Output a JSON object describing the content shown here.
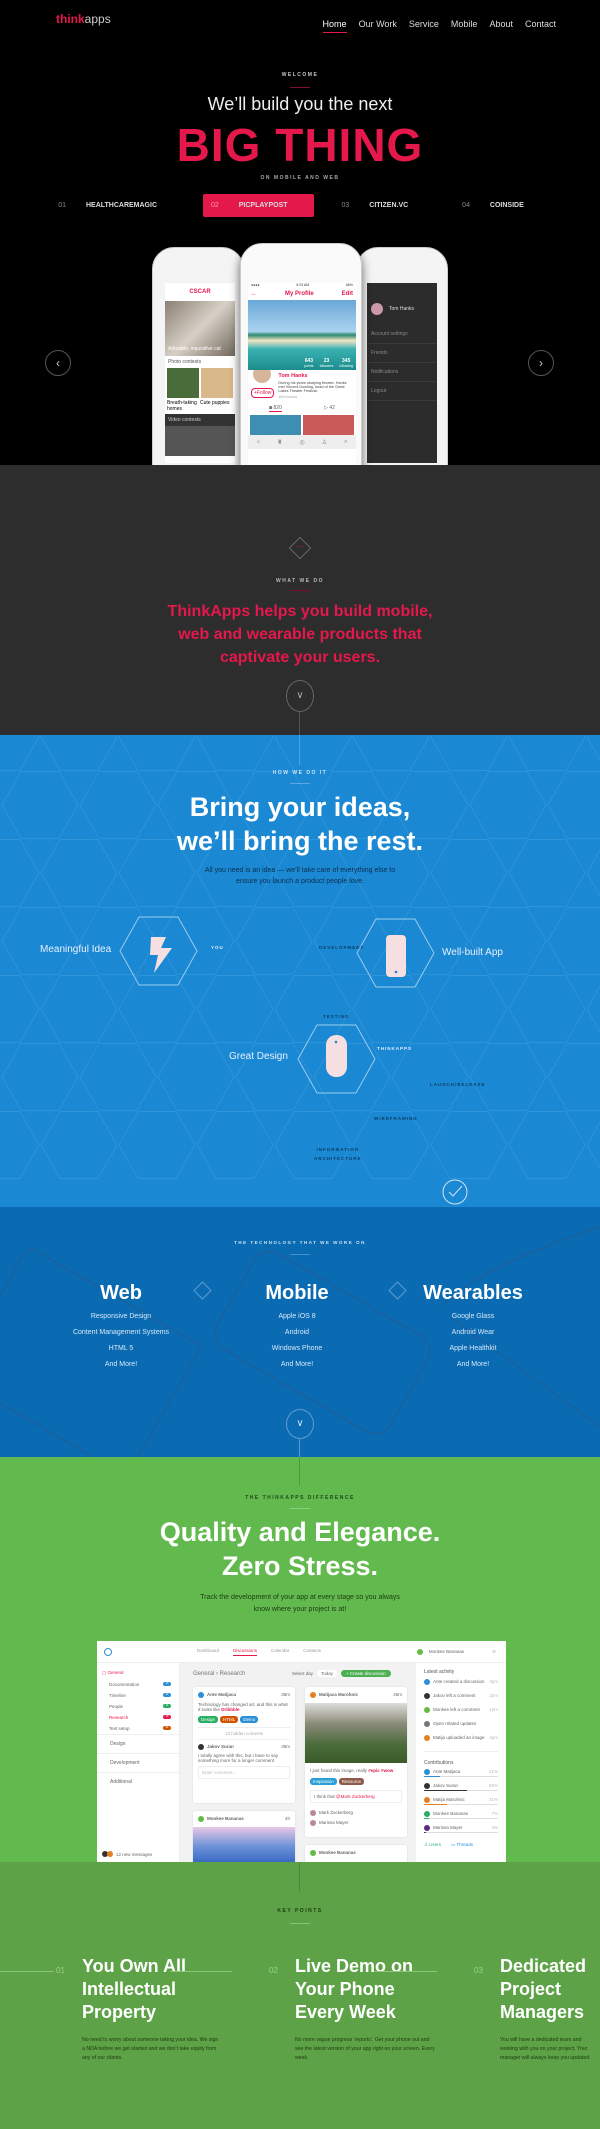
{
  "colors": {
    "accent": "#e5184b",
    "hero_bg": "#000000",
    "gray_bg": "#2d2d2d",
    "blue": "#1a88d2",
    "blue_dark": "#0a6bb3",
    "green": "#62ba4f",
    "green_dark": "#5da247"
  },
  "nav": {
    "logo_bold": "think",
    "logo_light": "apps",
    "items": [
      "Home",
      "Our Work",
      "Service",
      "Mobile",
      "About",
      "Contact"
    ],
    "active": "Home"
  },
  "hero": {
    "eyebrow": "WELCOME",
    "line1": "We’ll build you the next",
    "headline": "BIG THING",
    "sub": "ON MOBILE AND WEB",
    "tabs": [
      {
        "num": "01",
        "label": "HEALTHCAREMAGIC"
      },
      {
        "num": "02",
        "label": "PICPLAYPOST",
        "active": true
      },
      {
        "num": "03",
        "label": "CITIZEN.VC"
      },
      {
        "num": "04",
        "label": "COINSIDE"
      }
    ],
    "phone_center": {
      "time": "9:23 AM",
      "battery": "66%",
      "title": "My Profile",
      "edit": "Edit",
      "stats": [
        {
          "value": "643",
          "label": "points"
        },
        {
          "value": "23",
          "label": "followers"
        },
        {
          "value": "345",
          "label": "following"
        }
      ],
      "name": "Tom Hanks",
      "follow": "+Follow",
      "bio": "During his years studying theater, Hanks met Vincent Dowling, head of the Great Lakes Theater Festival.",
      "handle": "@tomhanks",
      "photos": "820",
      "videos": "42"
    },
    "phone_left": {
      "logo": "CSCAR",
      "caption": "Adorable, inquisitive cat",
      "section1": "Photo contests",
      "item1": "Breath-taking homes",
      "item2": "Cute puppies",
      "section2": "Video contests"
    },
    "phone_right": {
      "name": "Tom Hanks",
      "menu": [
        "Account settings",
        "Friends",
        "Notifications",
        "Logout"
      ]
    }
  },
  "what": {
    "eyebrow": "WHAT WE DO",
    "text": "ThinkApps helps you build mobile, web and wearable products that captivate your users."
  },
  "how": {
    "eyebrow": "HOW WE DO IT",
    "title1": "Bring your ideas,",
    "title2": "we’ll bring the rest.",
    "text1": "All you need is an idea — we’ll take care of everything else to",
    "text2": "ensure you launch a product people love.",
    "nodes": {
      "idea": "Meaningful Idea",
      "app": "Well-built App",
      "design": "Great Design"
    },
    "labels": {
      "you": "YOU",
      "development": "DEVELOPMENT",
      "testing": "TESTING",
      "thinkapps": "THINKAPPS",
      "launch": "LAUNCH/RELEASE",
      "wireframing": "WIREFRAMING",
      "ia1": "INFORMATION",
      "ia2": "ARCHITECTURE"
    }
  },
  "tech": {
    "eyebrow": "THE TECHNOLOGY THAT WE WORK ON",
    "columns": [
      {
        "title": "Web",
        "items": [
          "Responsive Design",
          "Content Management Systems",
          "HTML 5",
          "And More!"
        ]
      },
      {
        "title": "Mobile",
        "items": [
          "Apple iOS 8",
          "Android",
          "Windows Phone",
          "And More!"
        ]
      },
      {
        "title": "Wearables",
        "items": [
          "Google Glass",
          "Android Wear",
          "Apple Healthkit",
          "And More!"
        ]
      }
    ]
  },
  "diff": {
    "eyebrow": "THE THINKAPPS DIFFERENCE",
    "title1": "Quality and Elegance.",
    "title2": "Zero Stress.",
    "text1": "Track the development of your app at every stage so you always",
    "text2": "know where your project is at!"
  },
  "dashboard": {
    "tabs": [
      "Dashboard",
      "Discussions",
      "Calendar",
      "Contacts"
    ],
    "active_tab": "Discussions",
    "user": "Monkee Bananas",
    "sidebar": {
      "general": "General",
      "items": [
        {
          "label": "Documentation",
          "count": "15",
          "color": "#2a8fd6"
        },
        {
          "label": "Timeline",
          "count": "24",
          "color": "#2a8fd6"
        },
        {
          "label": "People",
          "count": "11",
          "color": "#27ae60"
        },
        {
          "label": "Research",
          "count": "18",
          "color": "#e5184b"
        },
        {
          "label": "Test setup",
          "count": "21",
          "color": "#d35400"
        }
      ],
      "sections": [
        "Design",
        "Development",
        "Additional"
      ],
      "footer": "12 new messages"
    },
    "breadcrumb": "General › Research",
    "select_day": "Select day",
    "day": "Today",
    "create": "+ Create discussion",
    "post1": {
      "author": "Ante Matijaca",
      "time": "35m",
      "text": "Technology has changed art, and this is what it looks like",
      "link": "Dribbble",
      "tags": [
        "Design",
        "HTML",
        "Demo"
      ],
      "hidden": "13 hidden coments",
      "reply_author": "Jakov Suran",
      "reply_time": "35m",
      "reply": "I totally agree with this, but I have to say something more for a longer comment",
      "input": "Enter comment..."
    },
    "post2": {
      "author": "Matijaca Marohnic",
      "time": "45m",
      "text": "I just found this image, really",
      "link": "#epic #wow",
      "tags": [
        "Inspiration",
        "Resource"
      ],
      "comment": "I think that",
      "mention": "@Mark Zuckerberg",
      "people": [
        "Mark Zuckerberg",
        "Marissa Mayer"
      ]
    },
    "post3": {
      "author": "Monkee Bananas",
      "time": "4h"
    },
    "activity_title": "Latest activity",
    "activity": [
      {
        "text": "Ante created a discussion",
        "time": "3pm"
      },
      {
        "text": "Jakov left a comment",
        "time": "2pm"
      },
      {
        "text": "Monkee left a comment",
        "time": "1pm"
      },
      {
        "text": "Open related updates",
        "time": ""
      },
      {
        "text": "Matija uploaded an image",
        "time": "4pm"
      }
    ],
    "contrib_title": "Contributions",
    "contributions": [
      {
        "name": "Ante Matijaca",
        "pct": 21,
        "color": "#2a8fd6"
      },
      {
        "name": "Jakov Suran",
        "pct": 58,
        "color": "#333333"
      },
      {
        "name": "Matija Marohnic",
        "pct": 31,
        "color": "#e67e22"
      },
      {
        "name": "Monkee Bananas",
        "pct": 7,
        "color": "#27ae60"
      },
      {
        "name": "Marissa Mayer",
        "pct": 3,
        "color": "#5b2a86"
      }
    ],
    "footer_links": [
      "Users",
      "Threads"
    ]
  },
  "keypoints": {
    "eyebrow": "KEY POINTS",
    "items": [
      {
        "num": "01",
        "title": "You Own All Intellectual Property",
        "text": "No need to worry about someone taking your idea. We sign a NDA before we get started and we don’t take equity from any of our clients."
      },
      {
        "num": "02",
        "title": "Live Demo on Your Phone Every Week",
        "text": "No more vague progress ‘reports’. Get your phone out and see the latest version of your app right on your screen. Every week."
      },
      {
        "num": "03",
        "title": "Dedicated Project Managers",
        "text": "You will have a dedicated team and working with you on your project. Your manager will always keep you updated."
      }
    ]
  }
}
